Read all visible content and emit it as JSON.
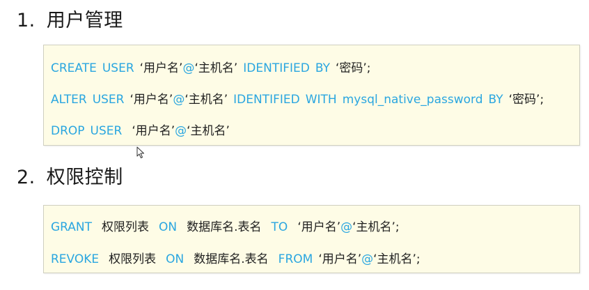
{
  "section1": {
    "number": "1.",
    "title": "用户管理",
    "lines": [
      {
        "create": "CREATE",
        "user": "USER",
        "name": "‘用户名’",
        "at": "@",
        "host": "‘主机名’",
        "identified": "IDENTIFIED",
        "by": "BY",
        "pwd": "‘密码’;"
      },
      {
        "alter": "ALTER",
        "user": "USER",
        "name": "‘用户名’",
        "at": "@",
        "host": "‘主机名’",
        "identified": "IDENTIFIED",
        "with": "WITH",
        "plugin": "mysql_native_password",
        "by": "BY",
        "pwd": "‘密码’;"
      },
      {
        "drop": "DROP",
        "user": "USER",
        "name": "‘用户名’",
        "at": "@",
        "host": "‘主机名’"
      }
    ]
  },
  "section2": {
    "number": "2.",
    "title": "权限控制",
    "lines": [
      {
        "grant": "GRANT",
        "privs": "权限列表",
        "on": "ON",
        "target": "数据库名.表名",
        "to": "TO",
        "name": "‘用户名’",
        "at": "@",
        "host": "‘主机名’;"
      },
      {
        "revoke": "REVOKE",
        "privs": "权限列表",
        "on": "ON",
        "target": "数据库名.表名",
        "from": "FROM",
        "name": "‘用户名’",
        "at": "@",
        "host": "‘主机名’;"
      }
    ]
  },
  "colors": {
    "keyword": "#2aa6e0",
    "box_background": "#fefce6",
    "box_border": "#cfcfc0"
  },
  "icons": {
    "cursor": "mouse-pointer-icon"
  }
}
